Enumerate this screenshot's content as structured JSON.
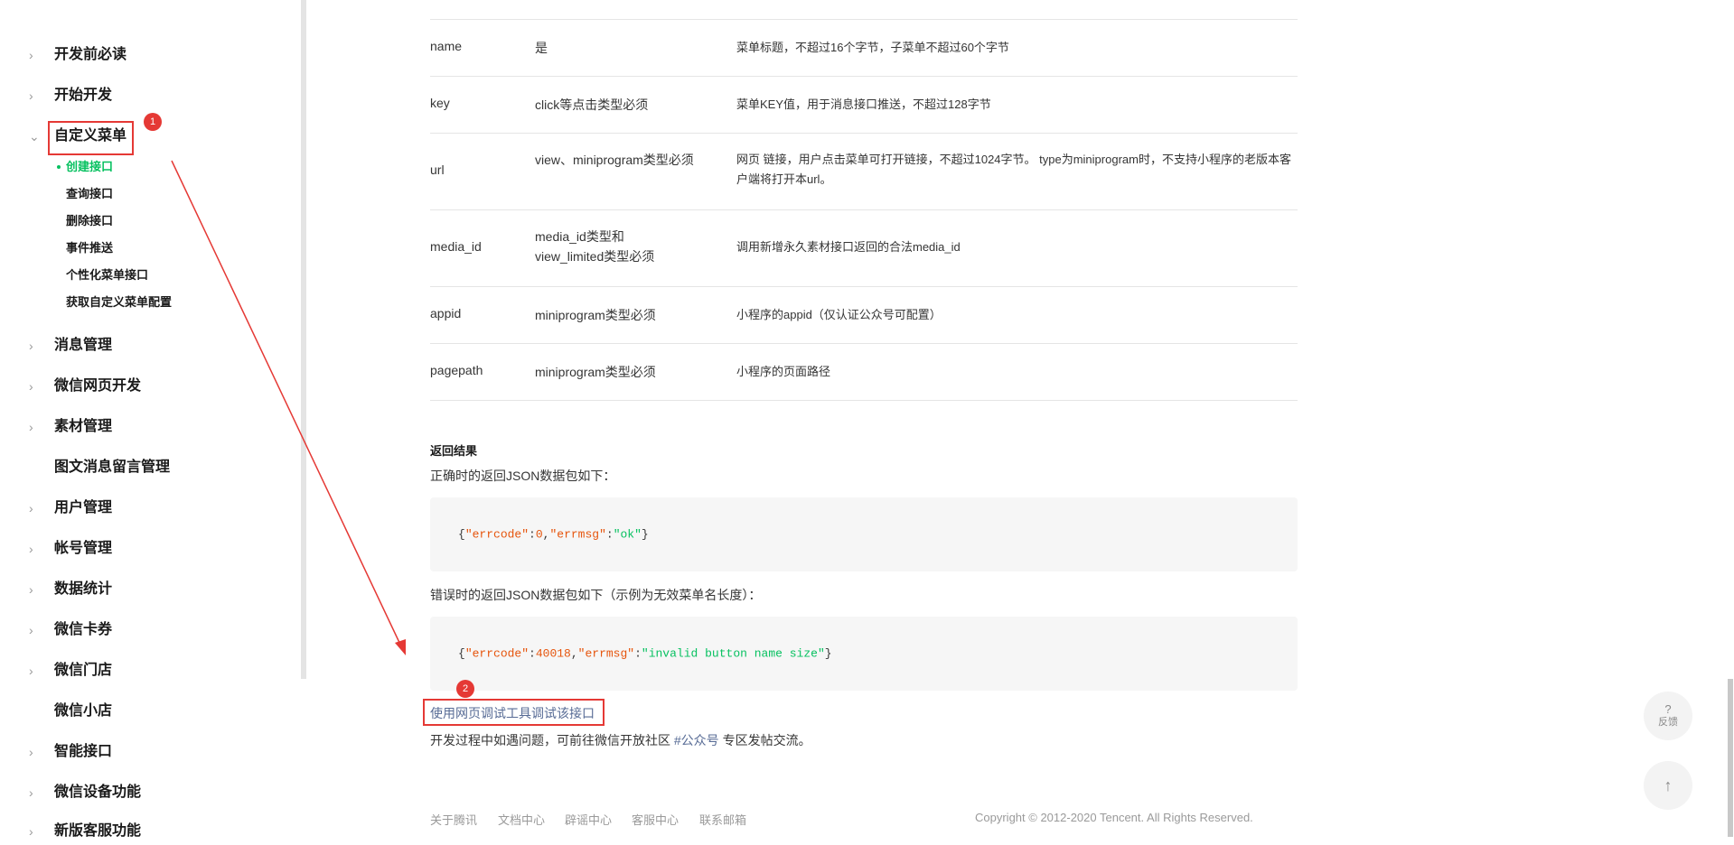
{
  "sidebar": {
    "items": [
      {
        "label": "开发前必读",
        "chevron": "›"
      },
      {
        "label": "开始开发",
        "chevron": "›"
      },
      {
        "label": "自定义菜单",
        "chevron": "⌄"
      },
      {
        "label": "消息管理",
        "chevron": "›"
      },
      {
        "label": "微信网页开发",
        "chevron": "›"
      },
      {
        "label": "素材管理",
        "chevron": "›"
      },
      {
        "label": "图文消息留言管理",
        "chevron": ""
      },
      {
        "label": "用户管理",
        "chevron": "›"
      },
      {
        "label": "帐号管理",
        "chevron": "›"
      },
      {
        "label": "数据统计",
        "chevron": "›"
      },
      {
        "label": "微信卡券",
        "chevron": "›"
      },
      {
        "label": "微信门店",
        "chevron": "›"
      },
      {
        "label": "微信小店",
        "chevron": ""
      },
      {
        "label": "智能接口",
        "chevron": "›"
      },
      {
        "label": "微信设备功能",
        "chevron": "›"
      },
      {
        "label": "新版客服功能",
        "chevron": "›"
      }
    ],
    "subitems": [
      "创建接口",
      "查询接口",
      "删除接口",
      "事件推送",
      "个性化菜单接口",
      "获取自定义菜单配置"
    ]
  },
  "table": {
    "rows": [
      {
        "param": "name",
        "required": "是",
        "desc": "菜单标题，不超过16个字节，子菜单不超过60个字节"
      },
      {
        "param": "key",
        "required": "click等点击类型必须",
        "desc": "菜单KEY值，用于消息接口推送，不超过128字节"
      },
      {
        "param": "url",
        "required": "view、miniprogram类型必须",
        "desc": "网页 链接，用户点击菜单可打开链接，不超过1024字节。 type为miniprogram时，不支持小程序的老版本客户端将打开本url。"
      },
      {
        "param": "media_id",
        "required": "media_id类型和view_limited类型必须",
        "desc": "调用新增永久素材接口返回的合法media_id"
      },
      {
        "param": "appid",
        "required": "miniprogram类型必须",
        "desc": "小程序的appid（仅认证公众号可配置）"
      },
      {
        "param": "pagepath",
        "required": "miniprogram类型必须",
        "desc": "小程序的页面路径"
      }
    ]
  },
  "result": {
    "heading": "返回结果",
    "success_text": "正确时的返回JSON数据包如下：",
    "success_code": {
      "open": "{",
      "k1": "\"errcode\"",
      "v1": "0",
      "k2": "\"errmsg\"",
      "v2": "\"ok\"",
      "close": "}"
    },
    "error_text": "错误时的返回JSON数据包如下（示例为无效菜单名长度）：",
    "error_code": {
      "open": "{",
      "k1": "\"errcode\"",
      "v1": "40018",
      "k2": "\"errmsg\"",
      "v2": "\"invalid button name size\"",
      "close": "}"
    },
    "debug_link": "使用网页调试工具调试该接口",
    "community_prefix": "开发过程中如遇问题，可前往微信开放社区 ",
    "community_link": "#公众号",
    "community_suffix": " 专区发帖交流。"
  },
  "annotations": {
    "badge1": "1",
    "badge2": "2"
  },
  "footer": {
    "links": [
      "关于腾讯",
      "文档中心",
      "辟谣中心",
      "客服中心",
      "联系邮箱"
    ],
    "copyright": "Copyright © 2012-2020 Tencent. All Rights Reserved."
  },
  "floating": {
    "feedback_icon": "?",
    "feedback_label": "反馈",
    "top_icon": "↑"
  },
  "colors": {
    "accent": "#07c160",
    "annotation": "#e53935",
    "link": "#576b95"
  }
}
